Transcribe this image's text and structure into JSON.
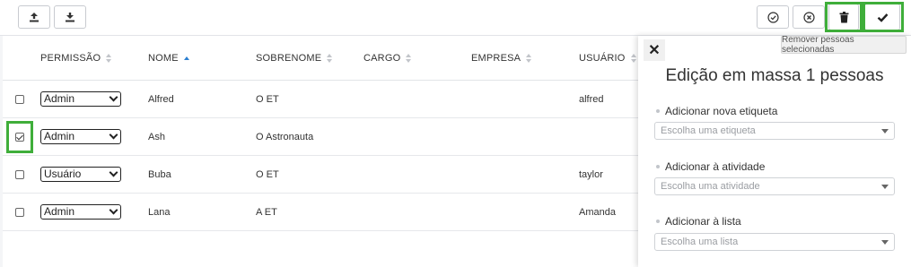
{
  "toolbar": {
    "upload_icon": "upload-icon",
    "download_icon": "download-icon",
    "check_circle_icon": "check-circle-icon",
    "x_circle_icon": "x-circle-icon",
    "trash_icon": "trash-icon",
    "checkmark_icon": "checkmark-icon",
    "tooltip": "Remover pessoas selecionadas",
    "highlight_color": "#3fae3a"
  },
  "table": {
    "columns": [
      "PERMISSÃO",
      "NOME",
      "SOBRENOME",
      "CARGO",
      "EMPRESA",
      "USUÁRIO"
    ],
    "rows": [
      {
        "checked": false,
        "permission": "Admin",
        "name": "Alfred",
        "surname": "O ET",
        "role": "",
        "company": "",
        "user": "alfred"
      },
      {
        "checked": true,
        "permission": "Admin",
        "name": "Ash",
        "surname": "O Astronauta",
        "role": "",
        "company": "",
        "user": ""
      },
      {
        "checked": false,
        "permission": "Usuário",
        "name": "Buba",
        "surname": "O ET",
        "role": "",
        "company": "",
        "user": "taylor"
      },
      {
        "checked": false,
        "permission": "Admin",
        "name": "Lana",
        "surname": "A ET",
        "role": "",
        "company": "",
        "user": "Amanda"
      }
    ]
  },
  "panel": {
    "close_label": "✕",
    "title": "Edição em massa 1 pessoas",
    "fields": [
      {
        "label": "Adicionar nova etiqueta",
        "placeholder": "Escolha uma etiqueta"
      },
      {
        "label": "Adicionar à atividade",
        "placeholder": "Escolha uma atividade"
      },
      {
        "label": "Adicionar à lista",
        "placeholder": "Escolha uma lista"
      }
    ]
  }
}
